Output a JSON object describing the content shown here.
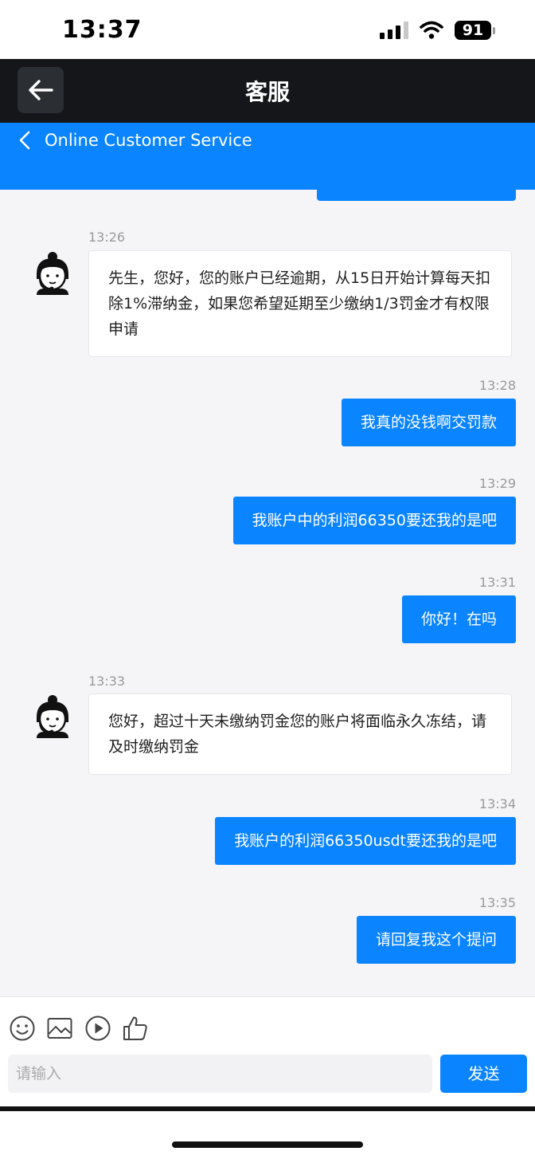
{
  "status_bar": {
    "time": "13:37",
    "battery": "91"
  },
  "header": {
    "title": "客服"
  },
  "banner": {
    "title": "Online Customer Service"
  },
  "messages": [
    {
      "side": "in",
      "time": "13:26",
      "text": "先生，您好，您的账户已经逾期，从15日开始计算每天扣除1%滞纳金，如果您希望延期至少缴纳1/3罚金才有权限申请"
    },
    {
      "side": "out",
      "time": "13:28",
      "text": "我真的没钱啊交罚款"
    },
    {
      "side": "out",
      "time": "13:29",
      "text": "我账户中的利润66350要还我的是吧"
    },
    {
      "side": "out",
      "time": "13:31",
      "text": "你好！在吗"
    },
    {
      "side": "in",
      "time": "13:33",
      "text": "您好，超过十天未缴纳罚金您的账户将面临永久冻结，请及时缴纳罚金"
    },
    {
      "side": "out",
      "time": "13:34",
      "text": "我账户的利润66350usdt要还我的是吧"
    },
    {
      "side": "out",
      "time": "13:35",
      "text": "请回复我这个提问"
    }
  ],
  "input": {
    "placeholder": "请输入",
    "value": "",
    "send_label": "发送"
  },
  "toolbar": [
    "emoji-icon",
    "image-icon",
    "video-icon",
    "thumbs-up-icon"
  ],
  "colors": {
    "accent": "#0a84ff",
    "header_bg": "#14161a",
    "chat_bg": "#f5f5f7"
  }
}
